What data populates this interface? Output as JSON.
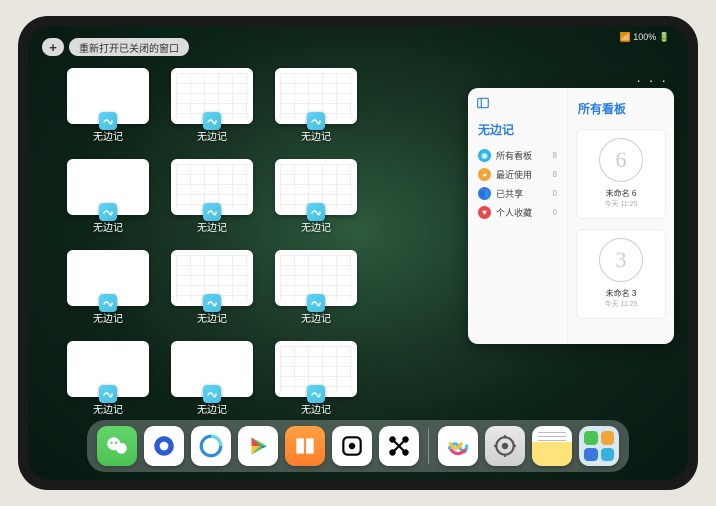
{
  "status": {
    "indicators": "📶 100% 🔋"
  },
  "toolbar": {
    "plus": "+",
    "reopen_label": "重新打开已关闭的窗口"
  },
  "app_name": "无边记",
  "windows": [
    {
      "label": "无边记",
      "variant": "blank"
    },
    {
      "label": "无边记",
      "variant": "grid"
    },
    {
      "label": "无边记",
      "variant": "grid"
    },
    {
      "label": "无边记",
      "variant": "blank"
    },
    {
      "label": "无边记",
      "variant": "grid"
    },
    {
      "label": "无边记",
      "variant": "grid"
    },
    {
      "label": "无边记",
      "variant": "blank"
    },
    {
      "label": "无边记",
      "variant": "grid"
    },
    {
      "label": "无边记",
      "variant": "grid"
    },
    {
      "label": "无边记",
      "variant": "blank"
    },
    {
      "label": "无边记",
      "variant": "blank"
    },
    {
      "label": "无边记",
      "variant": "grid"
    }
  ],
  "panel": {
    "left_title": "无边记",
    "nav": [
      {
        "label": "所有看板",
        "count": "8",
        "color": "#2bb6e6"
      },
      {
        "label": "最近使用",
        "count": "8",
        "color": "#f3a53b"
      },
      {
        "label": "已共享",
        "count": "0",
        "color": "#3a78e0"
      },
      {
        "label": "个人收藏",
        "count": "0",
        "color": "#e84a4a"
      }
    ],
    "right_title": "所有看板",
    "boards": [
      {
        "glyph": "6",
        "name": "未命名 6",
        "time": "今天 11:25"
      },
      {
        "glyph": "3",
        "name": "未命名 3",
        "time": "今天 11:25"
      }
    ]
  },
  "ellipsis": "· · ·",
  "dock": [
    {
      "name": "wechat"
    },
    {
      "name": "qq-browser"
    },
    {
      "name": "qq-browser-alt"
    },
    {
      "name": "play"
    },
    {
      "name": "books"
    },
    {
      "name": "dice"
    },
    {
      "name": "graph"
    },
    {
      "name": "freeform"
    },
    {
      "name": "settings"
    },
    {
      "name": "notes"
    },
    {
      "name": "app-library"
    }
  ]
}
